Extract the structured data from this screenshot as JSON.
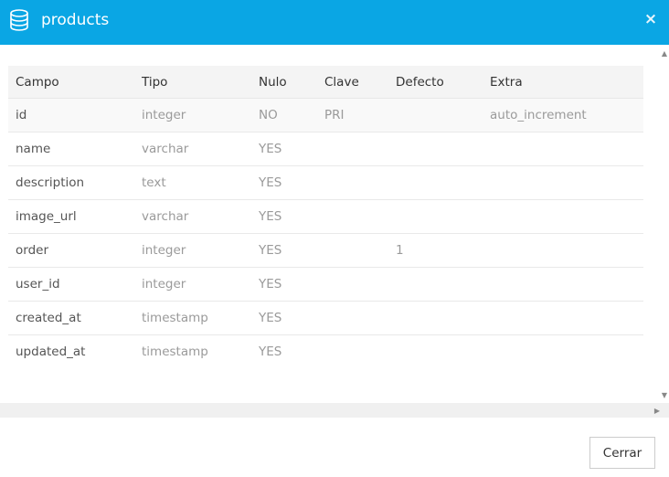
{
  "modal": {
    "title": "products",
    "title_icon": "database-icon",
    "close_glyph": "×"
  },
  "table": {
    "headers": {
      "field": "Campo",
      "type": "Tipo",
      "null": "Nulo",
      "key": "Clave",
      "default": "Defecto",
      "extra": "Extra"
    },
    "rows": [
      {
        "field": "id",
        "type": "integer",
        "null": "NO",
        "key": "PRI",
        "default": "",
        "extra": "auto_increment"
      },
      {
        "field": "name",
        "type": "varchar",
        "null": "YES",
        "key": "",
        "default": "",
        "extra": ""
      },
      {
        "field": "description",
        "type": "text",
        "null": "YES",
        "key": "",
        "default": "",
        "extra": ""
      },
      {
        "field": "image_url",
        "type": "varchar",
        "null": "YES",
        "key": "",
        "default": "",
        "extra": ""
      },
      {
        "field": "order",
        "type": "integer",
        "null": "YES",
        "key": "",
        "default": "1",
        "extra": ""
      },
      {
        "field": "user_id",
        "type": "integer",
        "null": "YES",
        "key": "",
        "default": "",
        "extra": ""
      },
      {
        "field": "created_at",
        "type": "timestamp",
        "null": "YES",
        "key": "",
        "default": "",
        "extra": ""
      },
      {
        "field": "updated_at",
        "type": "timestamp",
        "null": "YES",
        "key": "",
        "default": "",
        "extra": ""
      }
    ]
  },
  "scrollbars": {
    "up_glyph": "▲",
    "down_glyph": "▼",
    "right_glyph": "▶"
  },
  "footer": {
    "close_label": "Cerrar"
  },
  "colors": {
    "header_bg": "#0aa6e4",
    "header_text": "#ffffff",
    "table_header_bg": "#f4f4f4",
    "stripe_bg": "#f9f9f9",
    "muted_text": "#9a9a9a"
  }
}
